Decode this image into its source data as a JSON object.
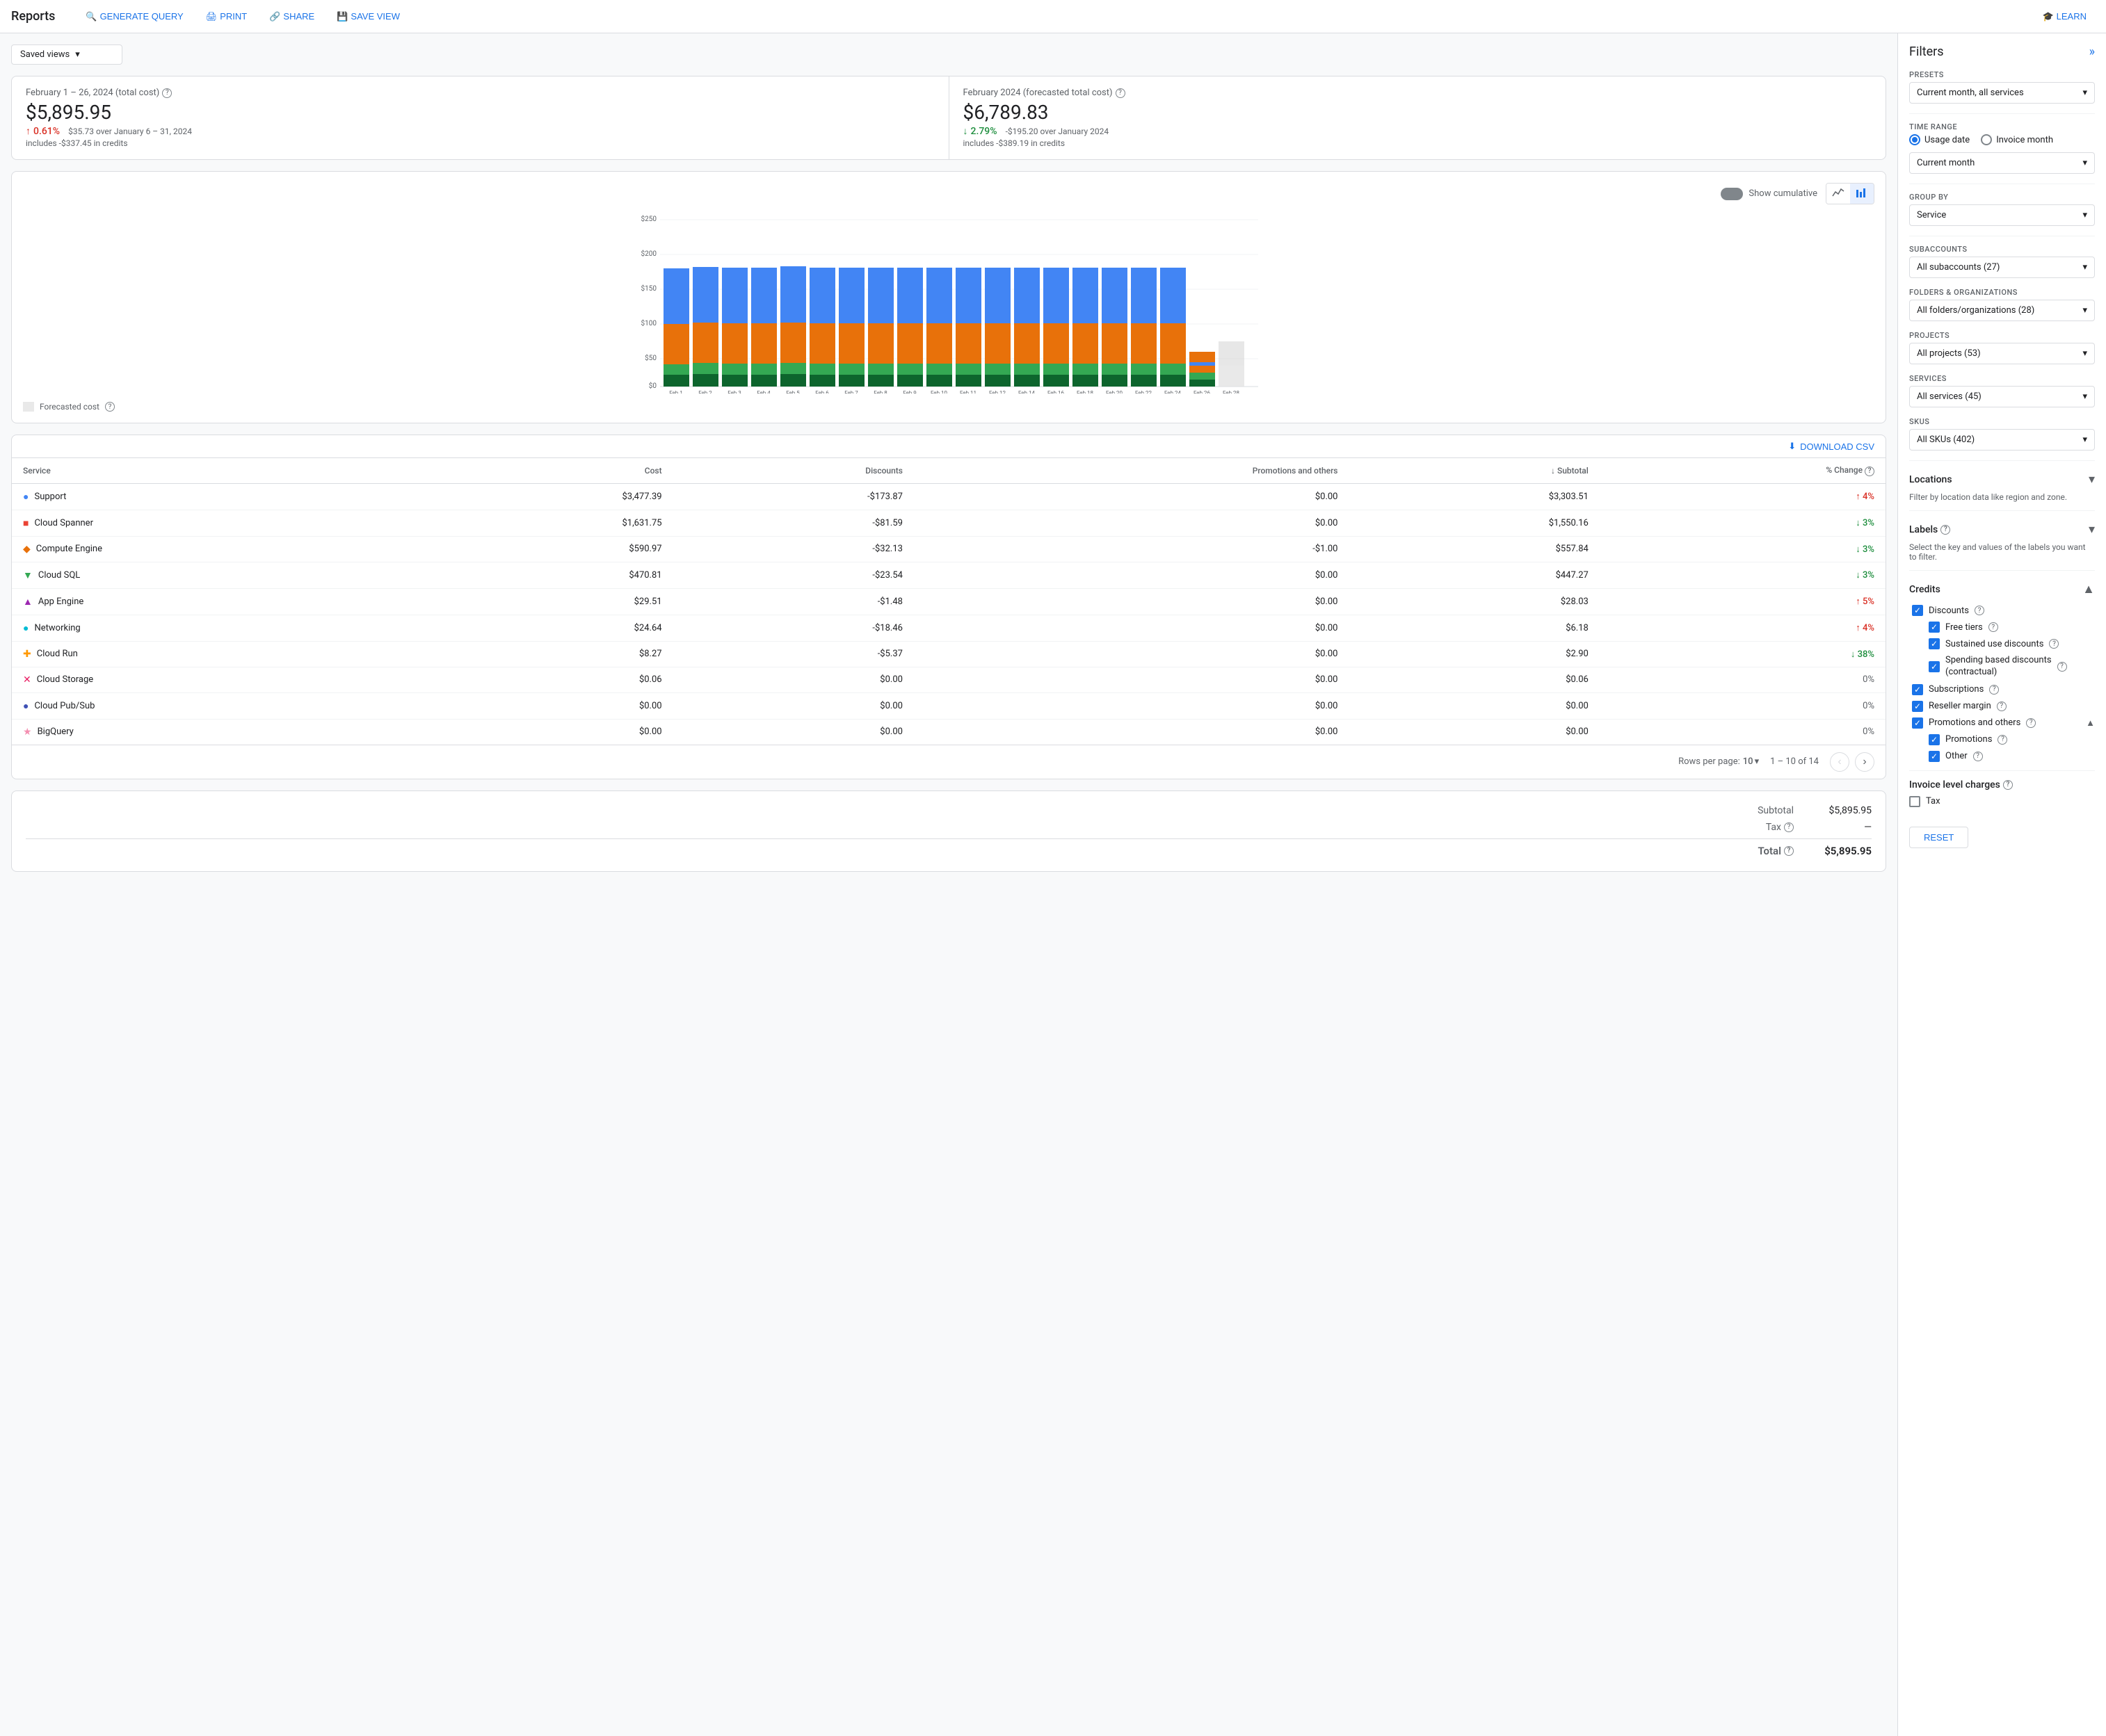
{
  "header": {
    "title": "Reports",
    "actions": [
      {
        "id": "generate-query",
        "label": "GENERATE QUERY",
        "icon": "🔍"
      },
      {
        "id": "print",
        "label": "PRINT",
        "icon": "🖨"
      },
      {
        "id": "share",
        "label": "SHARE",
        "icon": "🔗"
      },
      {
        "id": "save-view",
        "label": "SAVE VIEW",
        "icon": "💾"
      }
    ],
    "learn": "LEARN"
  },
  "savedViews": {
    "label": "Saved views",
    "placeholder": "Saved views"
  },
  "summaryCard1": {
    "title": "February 1 – 26, 2024 (total cost)",
    "value": "$5,895.95",
    "subtitle": "includes -$337.45 in credits",
    "changeValue": "0.61%",
    "changeDir": "up",
    "changeDetail": "$35.73 over January 6 – 31, 2024"
  },
  "summaryCard2": {
    "title": "February 2024 (forecasted total cost)",
    "value": "$6,789.83",
    "subtitle": "includes -$389.19 in credits",
    "changeValue": "2.79%",
    "changeDir": "down",
    "changeDetail": "-$195.20 over January 2024"
  },
  "chart": {
    "yLabels": [
      "$250",
      "$200",
      "$150",
      "$100",
      "$50",
      "$0"
    ],
    "xLabels": [
      "Feb 1",
      "Feb 2",
      "Feb 3",
      "Feb 4",
      "Feb 5",
      "Feb 6",
      "Feb 7",
      "Feb 8",
      "Feb 9",
      "Feb 10",
      "Feb 11",
      "Feb 12",
      "Feb 14",
      "Feb 16",
      "Feb 18",
      "Feb 20",
      "Feb 22",
      "Feb 24",
      "Feb 26",
      "Feb 28"
    ],
    "showCumulative": "Show cumulative",
    "forecastLabel": "Forecasted cost",
    "colors": {
      "blue": "#4285f4",
      "orange": "#ea4335",
      "red": "#e8710a",
      "green": "#34a853",
      "darkGreen": "#0d652d"
    }
  },
  "table": {
    "downloadLabel": "DOWNLOAD CSV",
    "columns": [
      "Service",
      "Cost",
      "Discounts",
      "Promotions and others",
      "↓ Subtotal",
      "% Change"
    ],
    "rows": [
      {
        "service": "Support",
        "color": "#4285f4",
        "shape": "circle",
        "cost": "$3,477.39",
        "discounts": "-$173.87",
        "promotions": "$0.00",
        "subtotal": "$3,303.51",
        "change": "4%",
        "changeDir": "up"
      },
      {
        "service": "Cloud Spanner",
        "color": "#ea4335",
        "shape": "square",
        "cost": "$1,631.75",
        "discounts": "-$81.59",
        "promotions": "$0.00",
        "subtotal": "$1,550.16",
        "change": "3%",
        "changeDir": "down"
      },
      {
        "service": "Compute Engine",
        "color": "#e8710a",
        "shape": "diamond",
        "cost": "$590.97",
        "discounts": "-$32.13",
        "promotions": "-$1.00",
        "subtotal": "$557.84",
        "change": "3%",
        "changeDir": "down"
      },
      {
        "service": "Cloud SQL",
        "color": "#34a853",
        "shape": "triangle-down",
        "cost": "$470.81",
        "discounts": "-$23.54",
        "promotions": "$0.00",
        "subtotal": "$447.27",
        "change": "3%",
        "changeDir": "down"
      },
      {
        "service": "App Engine",
        "color": "#9c27b0",
        "shape": "triangle-up",
        "cost": "$29.51",
        "discounts": "-$1.48",
        "promotions": "$0.00",
        "subtotal": "$28.03",
        "change": "5%",
        "changeDir": "up"
      },
      {
        "service": "Networking",
        "color": "#00bcd4",
        "shape": "circle",
        "cost": "$24.64",
        "discounts": "-$18.46",
        "promotions": "$0.00",
        "subtotal": "$6.18",
        "change": "4%",
        "changeDir": "up"
      },
      {
        "service": "Cloud Run",
        "color": "#ff9800",
        "shape": "plus",
        "cost": "$8.27",
        "discounts": "-$5.37",
        "promotions": "$0.00",
        "subtotal": "$2.90",
        "change": "38%",
        "changeDir": "down"
      },
      {
        "service": "Cloud Storage",
        "color": "#e91e63",
        "shape": "x",
        "cost": "$0.06",
        "discounts": "$0.00",
        "promotions": "$0.00",
        "subtotal": "$0.06",
        "change": "0%",
        "changeDir": "neutral"
      },
      {
        "service": "Cloud Pub/Sub",
        "color": "#3f51b5",
        "shape": "circle",
        "cost": "$0.00",
        "discounts": "$0.00",
        "promotions": "$0.00",
        "subtotal": "$0.00",
        "change": "0%",
        "changeDir": "neutral"
      },
      {
        "service": "BigQuery",
        "color": "#f48fb1",
        "shape": "star",
        "cost": "$0.00",
        "discounts": "$0.00",
        "promotions": "$0.00",
        "subtotal": "$0.00",
        "change": "0%",
        "changeDir": "neutral"
      }
    ],
    "rowsPerPage": "10",
    "rowsPerPageLabel": "Rows per page:",
    "pagination": "1 – 10 of 14"
  },
  "totals": {
    "subtotalLabel": "Subtotal",
    "subtotalValue": "$5,895.95",
    "taxLabel": "Tax",
    "taxValue": "—",
    "totalLabel": "Total",
    "totalValue": "$5,895.95"
  },
  "filters": {
    "title": "Filters",
    "presets": {
      "label": "Presets",
      "value": "Current month, all services"
    },
    "timeRange": {
      "label": "Time range",
      "usageDate": "Usage date",
      "invoiceMonth": "Invoice month",
      "currentMonth": "Current month"
    },
    "groupBy": {
      "label": "Group by",
      "value": "Service"
    },
    "subaccounts": {
      "label": "Subaccounts",
      "value": "All subaccounts (27)"
    },
    "folders": {
      "label": "Folders & Organizations",
      "value": "All folders/organizations (28)"
    },
    "projects": {
      "label": "Projects",
      "value": "All projects (53)"
    },
    "services": {
      "label": "Services",
      "value": "All services (45)"
    },
    "skus": {
      "label": "SKUs",
      "value": "All SKUs (402)"
    },
    "locations": {
      "label": "Locations",
      "note": "Filter by location data like region and zone."
    },
    "labels": {
      "label": "Labels",
      "note": "Select the key and values of the labels you want to filter."
    },
    "credits": {
      "label": "Credits",
      "discounts": {
        "label": "Discounts",
        "items": [
          {
            "label": "Free tiers",
            "checked": true
          },
          {
            "label": "Sustained use discounts",
            "checked": true
          },
          {
            "label": "Spending based discounts (contractual)",
            "checked": true
          }
        ]
      },
      "subscriptions": {
        "label": "Subscriptions",
        "checked": true
      },
      "resellerMargin": {
        "label": "Reseller margin",
        "checked": true
      },
      "promotionsAndOthers": {
        "label": "Promotions and others",
        "items": [
          {
            "label": "Promotions",
            "checked": true
          },
          {
            "label": "Other",
            "checked": true
          }
        ]
      }
    },
    "invoiceCharges": {
      "label": "Invoice level charges",
      "tax": {
        "label": "Tax",
        "checked": false
      }
    },
    "resetLabel": "RESET"
  }
}
